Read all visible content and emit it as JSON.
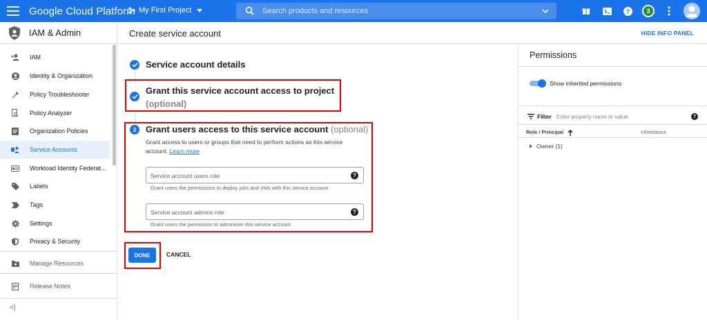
{
  "topbar": {
    "brand": "Google Cloud Platform",
    "project": "My First Project",
    "search_placeholder": "Search products and resources",
    "notifications_count": "3",
    "colors": {
      "bar": "#1a73e8"
    }
  },
  "leftnav": {
    "title": "IAM & Admin",
    "items": [
      {
        "label": "IAM",
        "icon": "person-add-icon"
      },
      {
        "label": "Identity & Organization",
        "icon": "account-circle-icon"
      },
      {
        "label": "Policy Troubleshooter",
        "icon": "wrench-icon"
      },
      {
        "label": "Policy Analyzer",
        "icon": "document-search-icon"
      },
      {
        "label": "Organization Policies",
        "icon": "list-document-icon"
      },
      {
        "label": "Service Accounts",
        "icon": "service-account-icon",
        "active": true
      },
      {
        "label": "Workload Identity Federat...",
        "icon": "id-card-icon"
      },
      {
        "label": "Labels",
        "icon": "label-icon"
      },
      {
        "label": "Tags",
        "icon": "tag-arrow-icon"
      },
      {
        "label": "Settings",
        "icon": "gear-icon"
      },
      {
        "label": "Privacy & Security",
        "icon": "shield-icon"
      }
    ],
    "bottom_items": [
      {
        "label": "Manage Resources",
        "icon": "folder-icon"
      },
      {
        "label": "Release Notes",
        "icon": "notes-icon"
      }
    ],
    "collapse_label": "<|"
  },
  "page": {
    "title": "Create service account",
    "hide_info_panel": "HIDE INFO PANEL"
  },
  "steps": {
    "step1_title": "Service account details",
    "step2_title": "Grant this service account access to project",
    "step2_optional": "(optional)",
    "step3_number": "3",
    "step3_title": "Grant users access to this service account",
    "step3_optional": "(optional)",
    "step3_desc": "Grant access to users or groups that need to perform actions as this service account.",
    "learn_more": "Learn more",
    "users_role_placeholder": "Service account users role",
    "users_role_hint": "Grant users the permissions to deploy jobs and VMs with this service account",
    "admins_role_placeholder": "Service account admins role",
    "admins_role_hint": "Grant users the permission to administer this service account",
    "done_label": "DONE",
    "cancel_label": "CANCEL"
  },
  "infopanel": {
    "title": "Permissions",
    "toggle_label": "Show inherited permissions",
    "toggle_on": true,
    "filter_label": "Filter",
    "filter_placeholder": "Enter property name or value",
    "col_role": "Role / Principal",
    "col_inheritance": "Inheritance",
    "rows": [
      {
        "label": "Owner (1)"
      }
    ]
  }
}
